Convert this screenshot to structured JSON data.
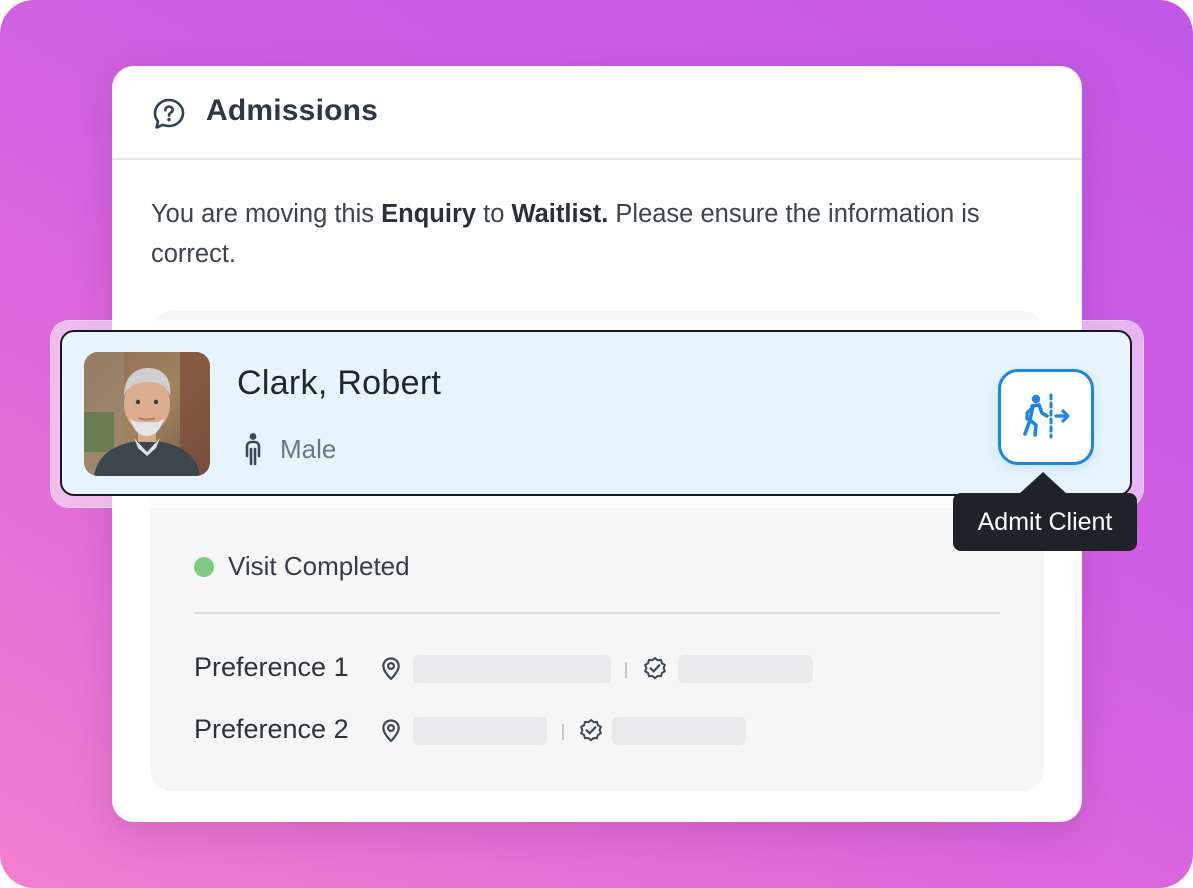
{
  "dialog": {
    "title": "Admissions",
    "message_prefix": "You are moving this ",
    "message_entity": "Enquiry",
    "message_mid": " to ",
    "message_target": "Waitlist.",
    "message_suffix": " Please ensure the information is correct."
  },
  "client": {
    "name": "Clark, Robert",
    "gender": "Male",
    "admit_tooltip": "Admit Client"
  },
  "status": {
    "label": "Visit Completed",
    "color": "#7dcb83"
  },
  "preferences": [
    {
      "label": "Preference 1"
    },
    {
      "label": "Preference 2"
    }
  ],
  "colors": {
    "accent": "#1a86e8",
    "highlight": "#e8f4fd",
    "tooltip": "#1f2226"
  }
}
